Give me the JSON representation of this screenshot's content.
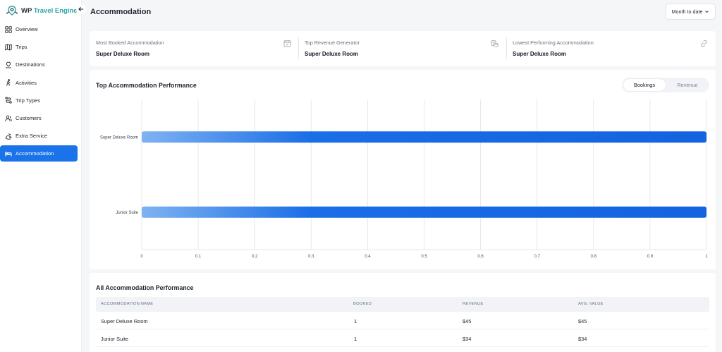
{
  "app": {
    "logo_wp": "WP",
    "logo_brand": "Travel Engine",
    "accent": "#1a73e8",
    "brand_color": "#2aa6a0"
  },
  "sidebar": {
    "items": [
      {
        "label": "Overview",
        "icon": "grid-icon"
      },
      {
        "label": "Trips",
        "icon": "map-icon"
      },
      {
        "label": "Destinations",
        "icon": "destination-icon"
      },
      {
        "label": "Activities",
        "icon": "activity-icon"
      },
      {
        "label": "Trip Types",
        "icon": "route-icon"
      },
      {
        "label": "Customers",
        "icon": "customers-icon"
      },
      {
        "label": "Extra Service",
        "icon": "service-icon"
      },
      {
        "label": "Accommodation",
        "icon": "bed-icon"
      }
    ],
    "active_index": 7
  },
  "header": {
    "title": "Accommodation",
    "period_select": "Month to date"
  },
  "stats": [
    {
      "label": "Most Booked Accommodation",
      "value": "Super Deluxe Room",
      "icon": "calendar-check-icon"
    },
    {
      "label": "Top Revenue Generator",
      "value": "Super Deluxe Room",
      "icon": "coins-icon"
    },
    {
      "label": "Lowest Performing Accommodation",
      "value": "Super Deluxe Room",
      "icon": "link-icon"
    }
  ],
  "performance": {
    "title": "Top Accommodation Performance",
    "toggle": {
      "bookings": "Bookings",
      "revenue": "Revenue",
      "selected": "Bookings"
    }
  },
  "chart_data": {
    "type": "bar",
    "orientation": "horizontal",
    "categories": [
      "Super Deluxe Room",
      "Junior Suite"
    ],
    "values": [
      1,
      1
    ],
    "xlim": [
      0,
      1
    ],
    "ticks": [
      "0",
      "0.1",
      "0.2",
      "0.3",
      "0.4",
      "0.5",
      "0.6",
      "0.7",
      "0.8",
      "0.9",
      "1"
    ],
    "title": "",
    "xlabel": "",
    "ylabel": "",
    "grid": true,
    "bar_color": "#1565e0"
  },
  "table": {
    "title": "All Accommodation Performance",
    "columns": [
      "ACCOMMODATION NAME",
      "BOOKED",
      "REVENUE",
      "AVG. VALUE"
    ],
    "rows": [
      [
        "Super Deluxe Room",
        "1",
        "$45",
        "$45"
      ],
      [
        "Junior Suite",
        "1",
        "$34",
        "$34"
      ]
    ]
  }
}
